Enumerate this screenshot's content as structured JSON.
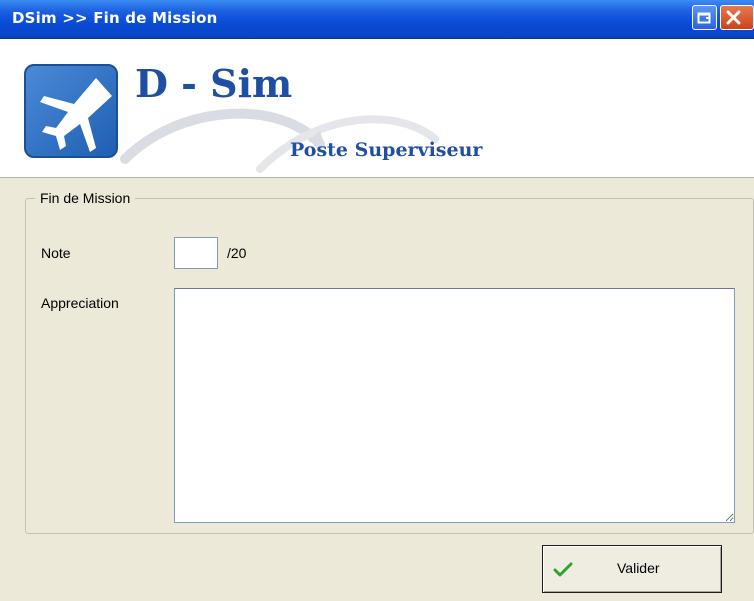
{
  "window": {
    "title": "DSim >> Fin de Mission",
    "buttons": {
      "restore_icon": "restore-icon",
      "close_icon": "close-icon"
    }
  },
  "header": {
    "brand": "D - Sim",
    "subtitle": "Poste Superviseur",
    "logo_icon": "jet-plane-icon"
  },
  "form": {
    "group_title": "Fin de Mission",
    "note_label": "Note",
    "note_value": "",
    "note_suffix": "/20",
    "appreciation_label": "Appreciation",
    "appreciation_value": ""
  },
  "actions": {
    "validate_label": "Valider",
    "validate_icon": "checkmark-icon"
  },
  "colors": {
    "titlebar": "#0a4cd6",
    "brand": "#1f4fa3",
    "dialog_bg": "#ece9d8",
    "check_green": "#2aa62a"
  }
}
